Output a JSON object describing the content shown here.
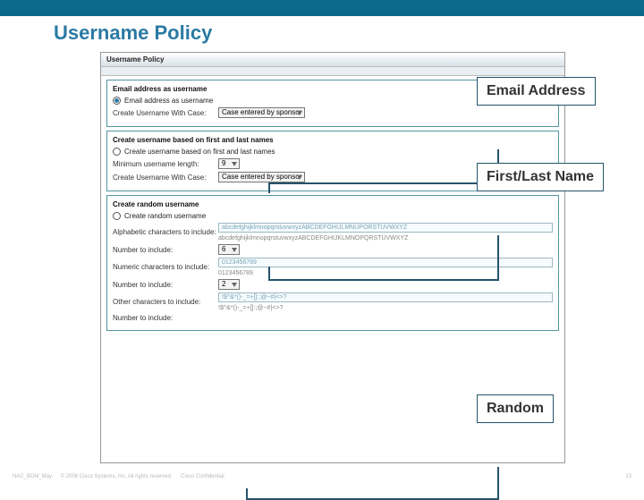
{
  "slide": {
    "title": "Username Policy"
  },
  "window": {
    "title": "Username Policy"
  },
  "sections": {
    "email": {
      "heading": "Email address as username",
      "radio_label": "Email address as username",
      "radio_selected": true,
      "case_label": "Create Username With Case:",
      "case_value": "Case entered by sponsor"
    },
    "first_last": {
      "heading": "Create username based on first and last names",
      "radio_label": "Create username based on first and last names",
      "radio_selected": false,
      "min_len_label": "Minimum username length:",
      "min_len_value": "9",
      "case_label": "Create Username With Case:",
      "case_value": "Case entered by sponsor"
    },
    "random": {
      "heading": "Create random username",
      "radio_label": "Create random username",
      "radio_selected": false,
      "alpha_label": "Alphabetic characters to include:",
      "alpha_sample": "abcdefghijklmnopqrstuvwxyzABCDEFGHIJKLMNOPQRSTUVWXYZ",
      "alpha_preview": "abcdefghijklmnopqrstuvwxyzABCDEFGHIJLMNUPORSTUVWXYZ",
      "alpha_count_label": "Number to include:",
      "alpha_count_value": "6",
      "num_label": "Numeric characters to include:",
      "num_sample": "0123456789",
      "num_preview": "0123456789",
      "num_count_label": "Number to include:",
      "num_count_value": "2",
      "other_label": "Other characters to include:",
      "other_sample": "!$^&*()-_=+[]:;@~#|<>?",
      "other_preview": "!$^&*()-_=+[]:;@~#|<>?",
      "other_count_label": "Number to include:"
    }
  },
  "callouts": {
    "email": "Email Address",
    "first_last": "First/Last Name",
    "random": "Random"
  },
  "footer": {
    "doc_id": "NAC_BDM_May",
    "copyright": "© 2006 Cisco Systems, Inc. All rights reserved.",
    "confidential": "Cisco Confidential",
    "page": "13"
  }
}
